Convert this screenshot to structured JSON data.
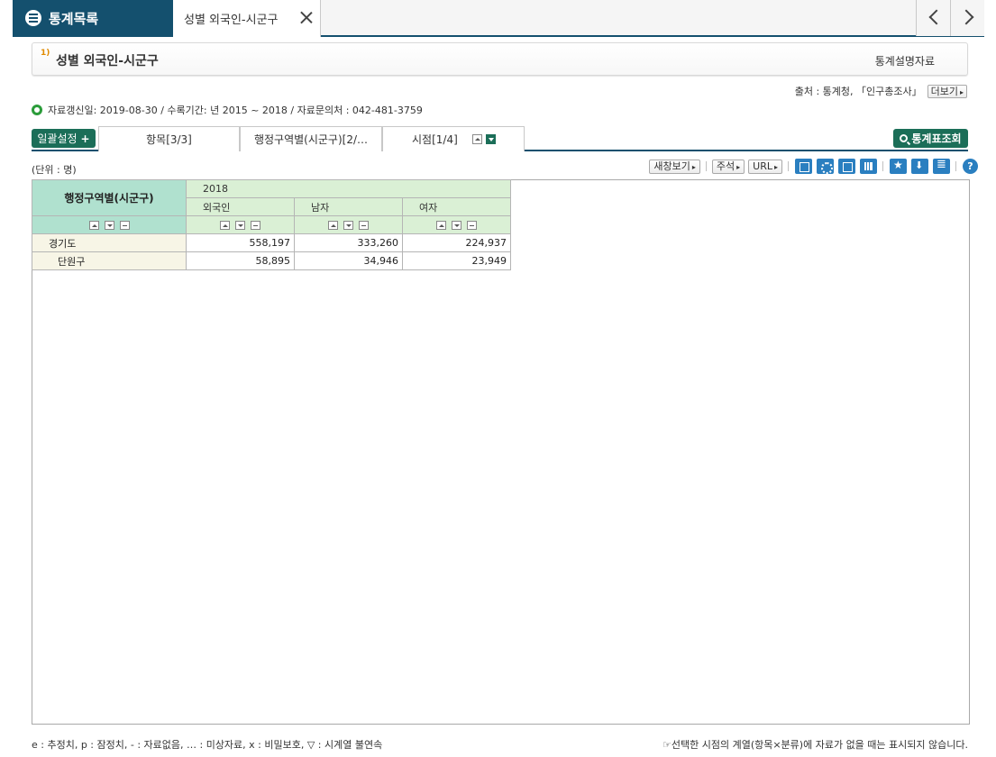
{
  "topbar": {
    "home_label": "통계목록",
    "active_tab": "성별 외국인-시군구"
  },
  "header": {
    "footnote_mark": "1)",
    "title": "성별 외국인-시군구",
    "meta_link": "통계설명자료"
  },
  "source": {
    "text": "출처 : 통계청, 「인구총조사」",
    "more_label": "더보기"
  },
  "update_info": "자료갱신일: 2019-08-30 / 수록기간: 년 2015 ~ 2018 / 자료문의처 : 042-481-3759",
  "toolbar": {
    "bulk_label": "일괄설정",
    "tabs": [
      "항목[3/3]",
      "행정구역별(시군구)[2/…",
      "시점[1/4]"
    ],
    "search_label": "통계표조회"
  },
  "unit": "(단위 : 명)",
  "tools": {
    "new_window": "새창보기",
    "annotation": "주석",
    "url": "URL",
    "help": "?"
  },
  "table": {
    "dim_header": "행정구역별(시군구)",
    "year": "2018",
    "columns": [
      "외국인",
      "남자",
      "여자"
    ],
    "rows": [
      {
        "label": "경기도",
        "values": [
          "558,197",
          "333,260",
          "224,937"
        ]
      },
      {
        "label": "단원구",
        "values": [
          "58,895",
          "34,946",
          "23,949"
        ]
      }
    ]
  },
  "footer": {
    "legend": "e : 추정치, p : 잠정치, - : 자료없음, … : 미상자료, x : 비밀보호, ▽ : 시계열 불연속",
    "note": "☞선택한 시점의 계열(항목×분류)에 자료가 없을 때는 표시되지 않습니다."
  }
}
